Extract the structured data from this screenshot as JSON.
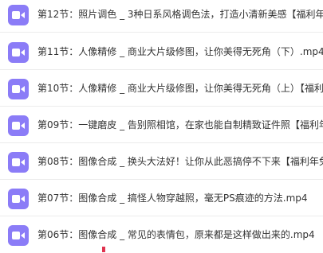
{
  "colors": {
    "icon_background": "#8b7cf7",
    "text": "#333333",
    "divider": "#ececec"
  },
  "files": [
    {
      "icon": "video-camera-icon",
      "name": "第12节：照片调色 _ 3种日系风格调色法，打造小清新美感【福利年"
    },
    {
      "icon": "video-camera-icon",
      "name": "第11节：人像精修 _ 商业大片级修图，让你美得无死角（下）.mp4"
    },
    {
      "icon": "video-camera-icon",
      "name": "第10节：人像精修 _ 商业大片级修图，让你美得无死角（上）【福利"
    },
    {
      "icon": "video-camera-icon",
      "name": "第09节：一键磨皮 _ 告别照相馆，在家也能自制精致证件照【福利年"
    },
    {
      "icon": "video-camera-icon",
      "name": "第08节：图像合成 _ 换头大法好！让你从此恶搞停不下来【福利年免"
    },
    {
      "icon": "video-camera-icon",
      "name": "第07节：图像合成 _ 搞怪人物穿越照，毫无PS痕迹的方法.mp4"
    },
    {
      "icon": "video-camera-icon",
      "name": "第06节：图像合成 _ 常见的表情包，原来都是这样做出来的.mp4"
    }
  ]
}
